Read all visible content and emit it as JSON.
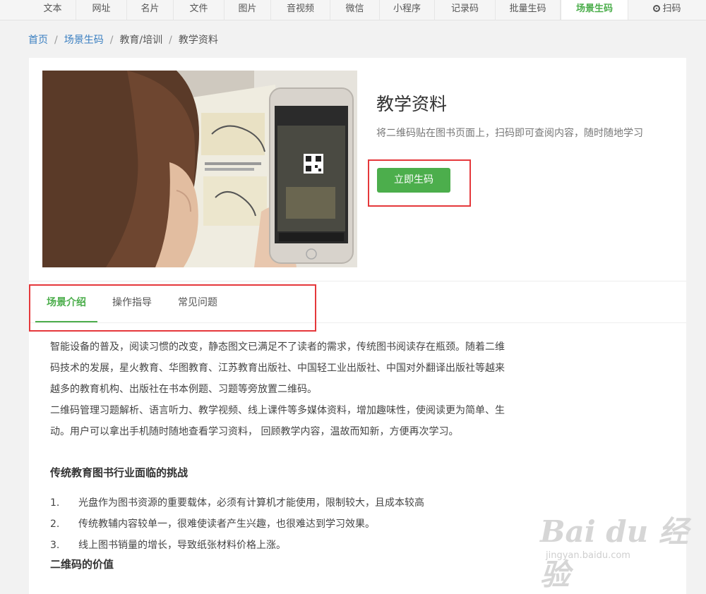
{
  "topnav": {
    "items": [
      "文本",
      "网址",
      "名片",
      "文件",
      "图片",
      "音视频",
      "微信",
      "小程序",
      "记录码",
      "批量生码",
      "场景生码"
    ],
    "scan_label": "扫码"
  },
  "breadcrumb": {
    "home": "首页",
    "scene": "场景生码",
    "category": "教育/培训",
    "current": "教学资料"
  },
  "hero": {
    "title": "教学资料",
    "description": "将二维码贴在图书页面上，扫码即可查阅内容，随时随地学习",
    "button": "立即生码"
  },
  "tabs": [
    "场景介绍",
    "操作指导",
    "常见问题"
  ],
  "intro": {
    "p1_lines": [
      "智能设备的普及，阅读习惯的改变，静态图文已满足不了读者的需求，传统图书阅读存在瓶颈。随着二维",
      "码技术的发展，星火教育、华图教育、江苏教育出版社、中国轻工业出版社、中国对外翻译出版社等越来",
      "越多的教育机构、出版社在书本例题、习题等旁放置二维码。"
    ],
    "p2_lines": [
      "二维码管理习题解析、语言听力、教学视频、线上课件等多媒体资料，增加趣味性，使阅读更为简单、生",
      "动。用户可以拿出手机随时随地查看学习资料， 回顾教学内容，温故而知新，方便再次学习。"
    ],
    "section1_title": "传统教育图书行业面临的挑战",
    "section1_items": [
      "光盘作为图书资源的重要载体，必须有计算机才能使用，限制较大，且成本较高",
      "传统教辅内容较单一，很难使读者产生兴趣，也很难达到学习效果。",
      "线上图书销量的增长，导致纸张材料价格上涨。"
    ],
    "section1_nums": [
      "1.",
      "2.",
      "3."
    ],
    "section2_title": "二维码的价值"
  },
  "watermark": {
    "brand": "Bai du 经验",
    "url": "jingyan.baidu.com"
  },
  "colors": {
    "accent": "#4cae4c",
    "link": "#3a7fc1",
    "highlight": "#e5383b"
  }
}
